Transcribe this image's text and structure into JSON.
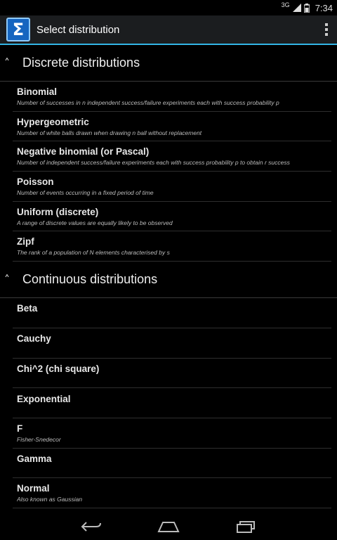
{
  "status": {
    "network": "3G",
    "time": "7:34"
  },
  "header": {
    "title": "Select distribution",
    "icon": "sigma-icon",
    "icon_glyph": "Σ"
  },
  "sections": [
    {
      "title": "Discrete distributions",
      "items": [
        {
          "name": "Binomial",
          "desc": "Number of successes in n independent success/failure experiments each with success probability p"
        },
        {
          "name": "Hypergeometric",
          "desc": "Number of white balls drawn when drawing n ball without replacement"
        },
        {
          "name": "Negative binomial (or Pascal)",
          "desc": "Number of independent success/failure experiments each with success probability p to obtain r success"
        },
        {
          "name": "Poisson",
          "desc": "Number of events occurring in a fixed period of time"
        },
        {
          "name": "Uniform (discrete)",
          "desc": "A range of discrete values are equally likely to be observed"
        },
        {
          "name": "Zipf",
          "desc": "The rank of a population of N elements characterised by s"
        }
      ]
    },
    {
      "title": "Continuous distributions",
      "items": [
        {
          "name": "Beta",
          "desc": ""
        },
        {
          "name": "Cauchy",
          "desc": ""
        },
        {
          "name": "Chi^2 (chi square)",
          "desc": ""
        },
        {
          "name": "Exponential",
          "desc": ""
        },
        {
          "name": "F",
          "desc": "Fisher-Snedecor"
        },
        {
          "name": "Gamma",
          "desc": ""
        },
        {
          "name": "Normal",
          "desc": "Also known as Gaussian"
        }
      ]
    }
  ],
  "nav": {
    "back": "back-icon",
    "home": "home-icon",
    "recents": "recents-icon"
  }
}
